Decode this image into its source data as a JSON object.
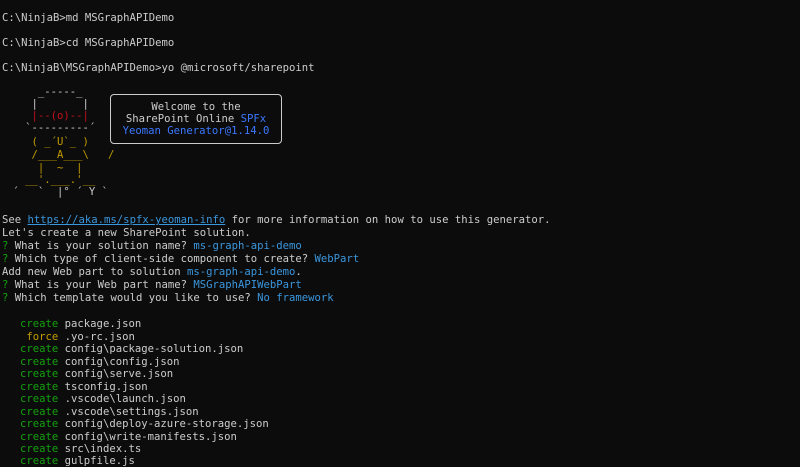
{
  "terminal": {
    "commands": [
      {
        "prompt": "C:\\NinjaB>",
        "cmd": "md MSGraphAPIDemo"
      },
      {
        "prompt": "C:\\NinjaB>",
        "cmd": "cd MSGraphAPIDemo"
      },
      {
        "prompt": "C:\\NinjaB\\MSGraphAPIDemo>",
        "cmd": "yo @microsoft/sharepoint"
      }
    ],
    "ascii_art": [
      "     _-----_",
      "    |       |",
      "    |--(o)--|",
      "   `---------´",
      "    ( _´U`_ )",
      "    /___A___\\   /",
      "     |  ~  |",
      "   __'.___.'__",
      " ´   `  |° ´ Y `"
    ],
    "welcome": {
      "line1": "Welcome to the",
      "line2_prefix": "SharePoint Online ",
      "line2_accent": "SPFx",
      "line3": "Yeoman Generator@1.14.0"
    },
    "info_prefix": "See ",
    "info_link": "https://aka.ms/spfx-yeoman-info",
    "info_suffix": " for more information on how to use this generator.",
    "lets_create": "Let's create a new SharePoint solution.",
    "questions": [
      {
        "mark": "?",
        "q": " What is your solution name? ",
        "a": "ms-graph-api-demo"
      },
      {
        "mark": "?",
        "q": " Which type of client-side component to create? ",
        "a": "WebPart"
      }
    ],
    "add_webpart_prefix": "Add new Web part to solution ",
    "add_webpart_name": "ms-graph-api-demo",
    "add_webpart_suffix": ".",
    "questions2": [
      {
        "mark": "?",
        "q": " What is your Web part name? ",
        "a": "MSGraphAPIWebPart"
      },
      {
        "mark": "?",
        "q": " Which template would you like to use? ",
        "a": "No framework"
      }
    ],
    "files": [
      {
        "action": "create",
        "path": "package.json"
      },
      {
        "action": " force",
        "path": ".yo-rc.json"
      },
      {
        "action": "create",
        "path": "config\\package-solution.json"
      },
      {
        "action": "create",
        "path": "config\\config.json"
      },
      {
        "action": "create",
        "path": "config\\serve.json"
      },
      {
        "action": "create",
        "path": "tsconfig.json"
      },
      {
        "action": "create",
        "path": ".vscode\\launch.json"
      },
      {
        "action": "create",
        "path": ".vscode\\settings.json"
      },
      {
        "action": "create",
        "path": "config\\deploy-azure-storage.json"
      },
      {
        "action": "create",
        "path": "config\\write-manifests.json"
      },
      {
        "action": "create",
        "path": "src\\index.ts"
      },
      {
        "action": "create",
        "path": "gulpfile.js"
      }
    ]
  }
}
